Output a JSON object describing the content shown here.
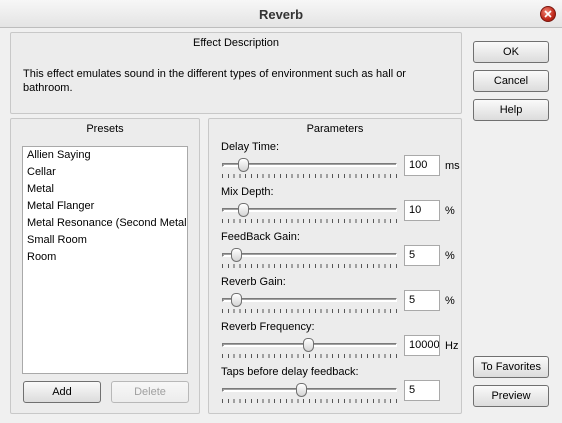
{
  "window": {
    "title": "Reverb"
  },
  "description": {
    "title": "Effect Description",
    "text": "This effect emulates sound in the different types of environment such as hall or bathroom."
  },
  "buttons": {
    "ok": "OK",
    "cancel": "Cancel",
    "help": "Help",
    "to_favorites": "To Favorites",
    "preview": "Preview"
  },
  "presets": {
    "title": "Presets",
    "items": [
      "Allien Saying",
      "Cellar",
      "Metal",
      "Metal Flanger",
      "Metal Resonance (Second Metal Version)",
      "Small Room",
      "Room"
    ],
    "add_label": "Add",
    "delete_label": "Delete"
  },
  "parameters": {
    "title": "Parameters",
    "items": [
      {
        "label": "Delay Time:",
        "value": "100",
        "unit": "ms",
        "level": 0.12
      },
      {
        "label": "Mix Depth:",
        "value": "10",
        "unit": "%",
        "level": 0.12
      },
      {
        "label": "FeedBack Gain:",
        "value": "5",
        "unit": "%",
        "level": 0.08
      },
      {
        "label": "Reverb Gain:",
        "value": "5",
        "unit": "%",
        "level": 0.08
      },
      {
        "label": "Reverb Frequency:",
        "value": "10000",
        "unit": "Hz",
        "level": 0.49
      },
      {
        "label": "Taps before delay feedback:",
        "value": "5",
        "unit": "",
        "level": 0.45
      }
    ]
  }
}
